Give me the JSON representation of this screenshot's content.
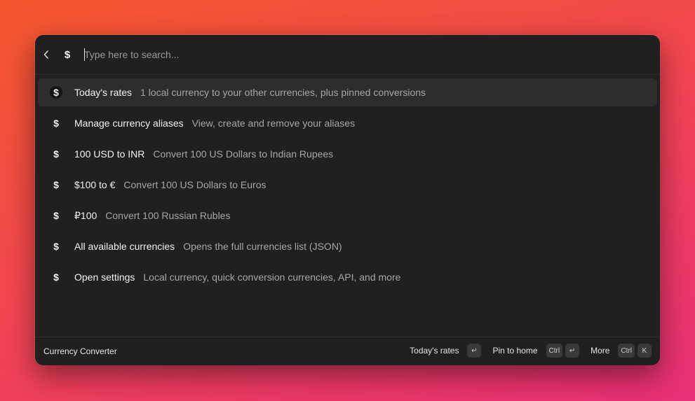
{
  "search": {
    "placeholder": "Type here to search...",
    "value": "",
    "extension_icon": "$"
  },
  "items": [
    {
      "icon": "$",
      "title": "Today's rates",
      "subtitle": "1 local currency to your other currencies, plus pinned conversions",
      "selected": true
    },
    {
      "icon": "$",
      "title": "Manage currency aliases",
      "subtitle": "View, create and remove your aliases"
    },
    {
      "icon": "$",
      "title": "100 USD to INR",
      "subtitle": "Convert 100 US Dollars to Indian Rupees"
    },
    {
      "icon": "$",
      "title": "$100 to €",
      "subtitle": "Convert 100 US Dollars to Euros"
    },
    {
      "icon": "$",
      "title": "₽100",
      "subtitle": "Convert 100 Russian Rubles"
    },
    {
      "icon": "$",
      "title": "All available currencies",
      "subtitle": "Opens the full currencies list (JSON)"
    },
    {
      "icon": "$",
      "title": "Open settings",
      "subtitle": "Local currency, quick conversion currencies, API, and more"
    }
  ],
  "footer": {
    "title": "Currency Converter",
    "actions": [
      {
        "label": "Today's rates",
        "keys": [
          "↵"
        ]
      },
      {
        "label": "Pin to home",
        "keys": [
          "Ctrl",
          "↵"
        ]
      },
      {
        "label": "More",
        "keys": [
          "Ctrl",
          "K"
        ]
      }
    ]
  },
  "colors": {
    "window_bg": "#202020",
    "selected_bg": "#2d2d2d",
    "text_primary": "#f2f2f2",
    "text_secondary": "#a6a6a6"
  }
}
